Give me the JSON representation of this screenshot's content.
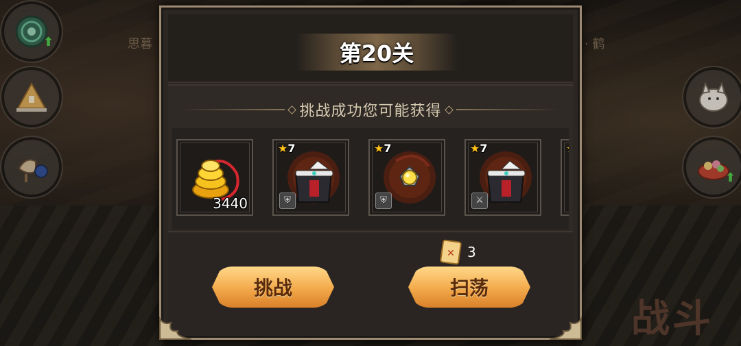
{
  "background": {
    "battle_label": "战斗",
    "side_text_left": "思暮",
    "side_text_right": "· 鹤"
  },
  "dialog": {
    "title": "第20关",
    "rewards_heading": "挑战成功您可能获得",
    "items": [
      {
        "icon": "gold-coin-pile-icon",
        "stars": "",
        "count": "3440",
        "badge": ""
      },
      {
        "icon": "dark-armor-icon",
        "stars": "7",
        "count": "",
        "badge": "shield-icon"
      },
      {
        "icon": "pendant-amulet-icon",
        "stars": "7",
        "count": "",
        "badge": "shield-icon"
      },
      {
        "icon": "dark-armor-icon",
        "stars": "7",
        "count": "",
        "badge": "sword-icon"
      }
    ],
    "ticket_count": "3",
    "challenge_button": "挑战",
    "sweep_button": "扫荡"
  },
  "colors": {
    "accent_gold": "#f3a94a",
    "frame": "#9c8a72",
    "panel": "#2c2723",
    "star": "#ffc21a"
  }
}
